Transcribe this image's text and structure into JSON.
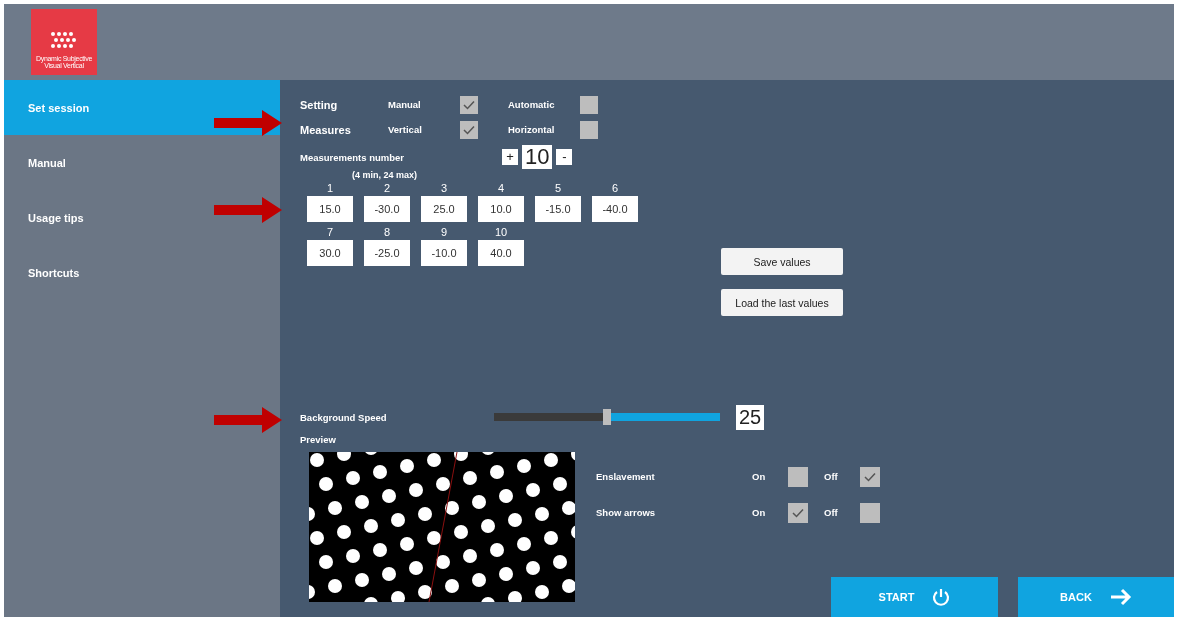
{
  "logo": {
    "text": "Dynamic Subjective Visual Vertical"
  },
  "sidebar": {
    "items": [
      {
        "label": "Set session",
        "selected": true
      },
      {
        "label": "Manual",
        "selected": false
      },
      {
        "label": "Usage tips",
        "selected": false
      },
      {
        "label": "Shortcuts",
        "selected": false
      }
    ]
  },
  "check_rows": [
    {
      "label": "Setting",
      "options": [
        {
          "label": "Manual",
          "checked": true
        },
        {
          "label": "Automatic",
          "checked": false
        }
      ]
    },
    {
      "label": "Measures",
      "options": [
        {
          "label": "Vertical",
          "checked": true
        },
        {
          "label": "Horizontal",
          "checked": false
        }
      ]
    }
  ],
  "measurements_number": {
    "label": "Measurements number",
    "hint": "(4 min, 24 max)",
    "increment": "+",
    "value": "10",
    "decrement": "-"
  },
  "values": [
    {
      "index": "1",
      "value": "15.0"
    },
    {
      "index": "2",
      "value": "-30.0"
    },
    {
      "index": "3",
      "value": "25.0"
    },
    {
      "index": "4",
      "value": "10.0"
    },
    {
      "index": "5",
      "value": "-15.0"
    },
    {
      "index": "6",
      "value": "-40.0"
    },
    {
      "index": "7",
      "value": "30.0"
    },
    {
      "index": "8",
      "value": "-25.0"
    },
    {
      "index": "9",
      "value": "-10.0"
    },
    {
      "index": "10",
      "value": "40.0"
    }
  ],
  "buttons": [
    "Save values",
    "Load the last values"
  ],
  "background_speed": {
    "label": "Background Speed",
    "level": 0.5,
    "value": "25"
  },
  "preview": {
    "label": "Preview"
  },
  "toggles": [
    {
      "label": "Enslavement",
      "options": [
        {
          "label": "On",
          "checked": false
        },
        {
          "label": "Off",
          "checked": true
        }
      ]
    },
    {
      "label": "Show arrows",
      "options": [
        {
          "label": "On",
          "checked": true
        },
        {
          "label": "Off",
          "checked": false
        }
      ]
    }
  ],
  "actions": [
    {
      "label": "START",
      "kind": "power"
    },
    {
      "label": "BACK",
      "kind": "arrow"
    }
  ]
}
